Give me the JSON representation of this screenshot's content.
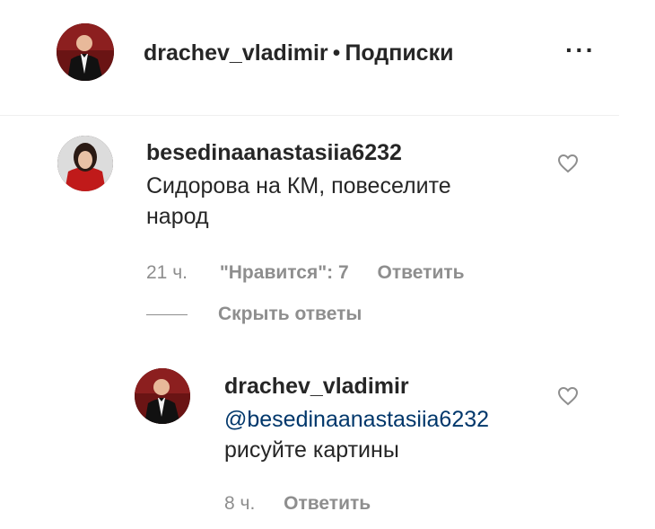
{
  "header": {
    "username": "drachev_vladimir",
    "separator": "•",
    "follow_label": "Подписки",
    "more_label": "···"
  },
  "comment": {
    "username": "besedinaanastasiia6232",
    "text": "Сидорова на КМ, повеселите народ",
    "time": "21 ч.",
    "likes": "\"Нравится\": 7",
    "reply_label": "Ответить",
    "hide_replies_label": "Скрыть ответы"
  },
  "reply": {
    "username": "drachev_vladimir",
    "mention": "@besedinaanastasiia6232",
    "text": "рисуйте картины",
    "time": "8 ч.",
    "reply_label": "Ответить"
  },
  "colors": {
    "text": "#262626",
    "muted": "#8e8e8e",
    "mention": "#00376b",
    "divider": "#efefef"
  },
  "icons": {
    "more": "more-options-icon",
    "like": "heart-icon"
  }
}
